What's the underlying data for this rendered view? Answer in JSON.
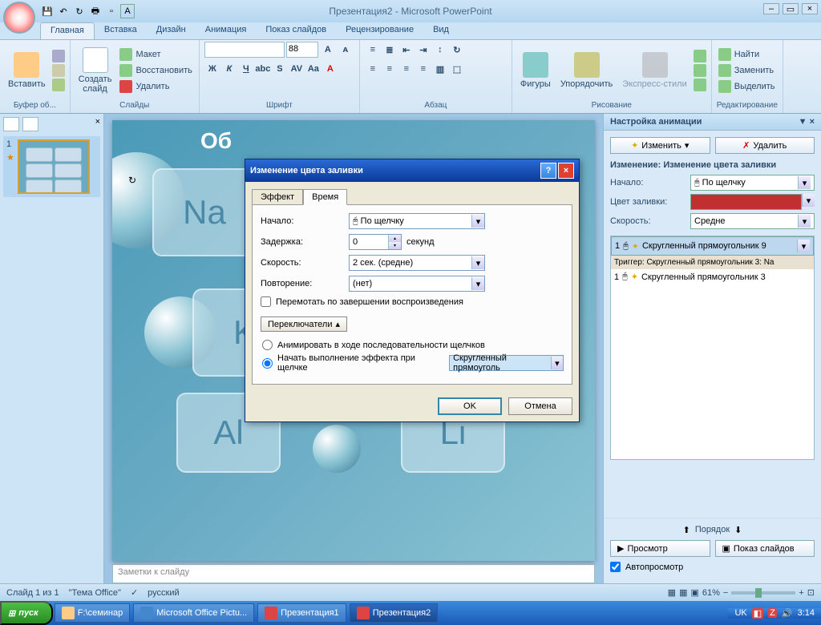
{
  "title": "Презентация2 - Microsoft PowerPoint",
  "tabs": {
    "home": "Главная",
    "insert": "Вставка",
    "design": "Дизайн",
    "anim": "Анимация",
    "show": "Показ слайдов",
    "review": "Рецензирование",
    "view": "Вид"
  },
  "ribbon": {
    "clipboard": {
      "label": "Буфер об...",
      "paste": "Вставить"
    },
    "slides": {
      "label": "Слайды",
      "new": "Создать\nслайд",
      "layout": "Макет",
      "reset": "Восстановить",
      "delete": "Удалить"
    },
    "font": {
      "label": "Шрифт",
      "size": "88",
      "b": "Ж",
      "i": "К",
      "u": "Ч"
    },
    "para": {
      "label": "Абзац"
    },
    "drawing": {
      "label": "Рисование",
      "shapes": "Фигуры",
      "arrange": "Упорядочить",
      "styles": "Экспресс-стили"
    },
    "editing": {
      "label": "Редактирование",
      "find": "Найти",
      "replace": "Заменить",
      "select": "Выделить"
    }
  },
  "thumb": {
    "num": "1",
    "star": "★"
  },
  "tiles": {
    "na": "Na",
    "k": "K",
    "al": "Al",
    "li": "Li",
    "obj_title": "Об"
  },
  "notes_placeholder": "Заметки к слайду",
  "anim_pane": {
    "title": "Настройка анимации",
    "change_btn": "Изменить",
    "delete_btn": "Удалить",
    "change_hdr": "Изменение: Изменение цвета заливки",
    "start_label": "Начало:",
    "start_val": "По щелчку",
    "color_label": "Цвет заливки:",
    "speed_label": "Скорость:",
    "speed_val": "Средне",
    "item1_num": "1",
    "item1_name": "Скругленный прямоугольник 9",
    "trigger": "Триггер: Скругленный прямоугольник 3: Na",
    "item2_num": "1",
    "item2_name": "Скругленный прямоугольник 3",
    "reorder": "Порядок",
    "preview": "Просмотр",
    "slideshow": "Показ слайдов",
    "autoprev": "Автопросмотр"
  },
  "dialog": {
    "title": "Изменение цвета заливки",
    "tab_effect": "Эффект",
    "tab_time": "Время",
    "start_label": "Начало:",
    "start_val": "По щелчку",
    "delay_label": "Задержка:",
    "delay_val": "0",
    "delay_unit": "секунд",
    "speed_label": "Скорость:",
    "speed_val": "2 сек. (средне)",
    "repeat_label": "Повторение:",
    "repeat_val": "(нет)",
    "rewind": "Перемотать по завершении воспроизведения",
    "triggers": "Переключатели",
    "radio1": "Анимировать в ходе последовательности щелчков",
    "radio2": "Начать выполнение эффекта при щелчке",
    "trigger_val": "Скругленный прямоуголь",
    "ok": "OK",
    "cancel": "Отмена"
  },
  "status": {
    "slide": "Слайд 1 из 1",
    "theme": "\"Тема Office\"",
    "lang": "русский",
    "zoom": "61%"
  },
  "taskbar": {
    "start": "пуск",
    "t1": "F:\\семинар",
    "t2": "Microsoft Office Pictu...",
    "t3": "Презентация1",
    "t4": "Презентация2",
    "lang": "UK",
    "time": "3:14"
  }
}
